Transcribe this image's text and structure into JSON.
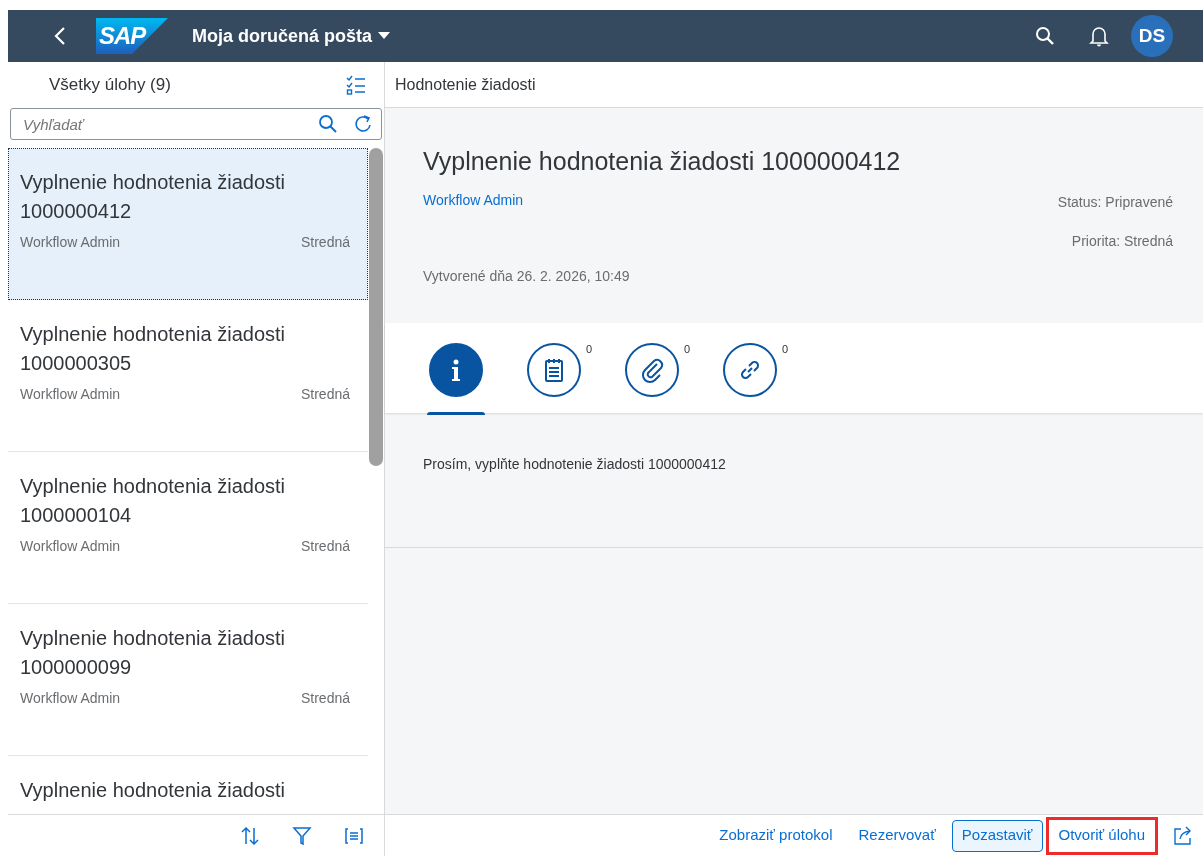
{
  "shell": {
    "logo": "SAP",
    "title": "Moja doručená pošta",
    "avatar": "DS"
  },
  "list": {
    "header": "Všetky úlohy (9)",
    "search": {
      "placeholder": "Vyhľadať"
    },
    "items": [
      {
        "title": "Vyplnenie hodnotenia žiadosti 1000000412",
        "creator": "Workflow Admin",
        "priority": "Stredná",
        "selected": true
      },
      {
        "title": "Vyplnenie hodnotenia žiadosti 1000000305",
        "creator": "Workflow Admin",
        "priority": "Stredná",
        "selected": false
      },
      {
        "title": "Vyplnenie hodnotenia žiadosti 1000000104",
        "creator": "Workflow Admin",
        "priority": "Stredná",
        "selected": false
      },
      {
        "title": "Vyplnenie hodnotenia žiadosti 1000000099",
        "creator": "Workflow Admin",
        "priority": "Stredná",
        "selected": false
      },
      {
        "title": "Vyplnenie hodnotenia žiadosti",
        "selected": false
      }
    ]
  },
  "detail": {
    "header": "Hodnotenie žiadosti",
    "title": "Vyplnenie hodnotenia žiadosti 1000000412",
    "creator": "Workflow Admin",
    "status": "Status: Pripravené",
    "priority": "Priorita: Stredná",
    "created": "Vytvorené dňa 26. 2. 2026, 10:49",
    "tabs": [
      {
        "kind": "info",
        "selected": true
      },
      {
        "kind": "notes",
        "count": "0",
        "selected": false
      },
      {
        "kind": "attachments",
        "count": "0",
        "selected": false
      },
      {
        "kind": "links",
        "count": "0",
        "selected": false
      }
    ],
    "description": "Prosím, vyplňte hodnotenie žiadosti 1000000412"
  },
  "footer_buttons": [
    {
      "label": "Zobraziť protokol",
      "emphasized": false,
      "highlighted": false
    },
    {
      "label": "Rezervovať",
      "emphasized": false,
      "highlighted": false
    },
    {
      "label": "Pozastaviť",
      "emphasized": true,
      "highlighted": false
    },
    {
      "label": "Otvoriť úlohu",
      "emphasized": false,
      "highlighted": true
    }
  ]
}
